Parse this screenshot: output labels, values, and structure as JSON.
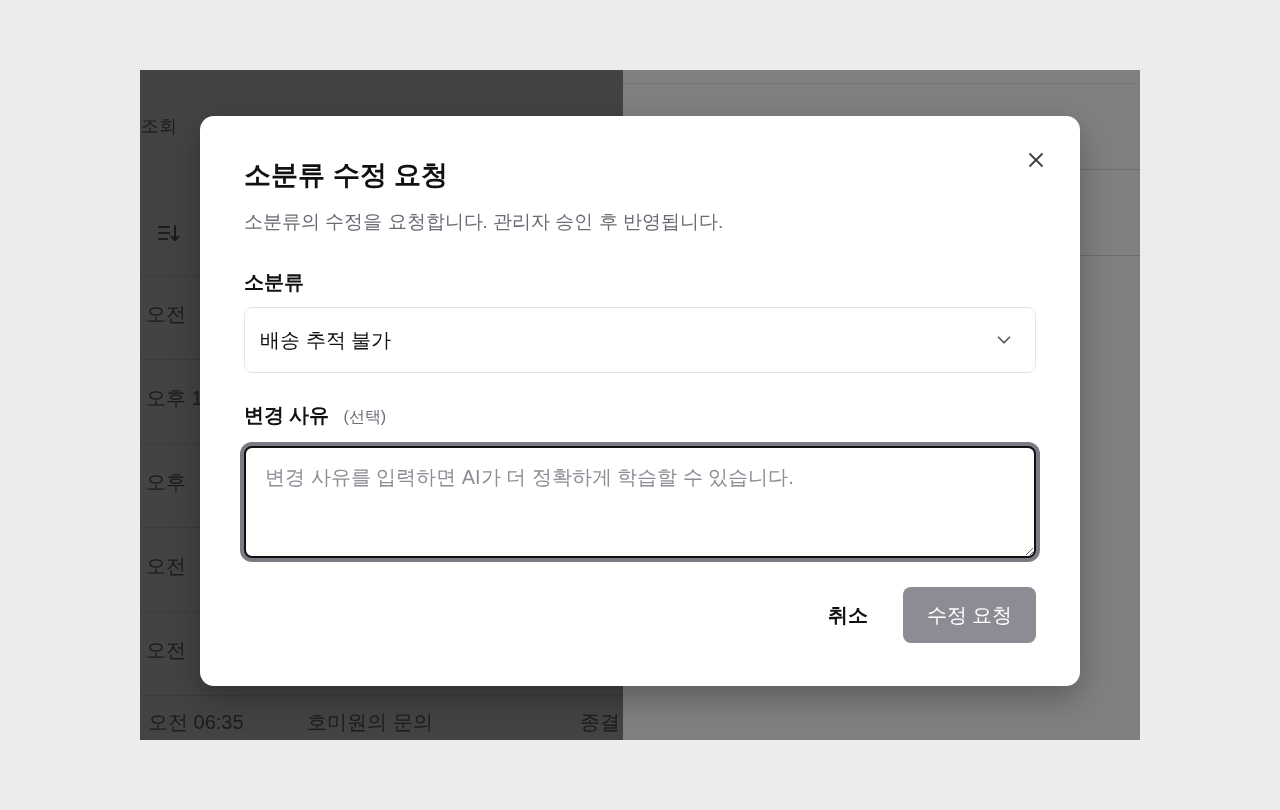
{
  "background": {
    "list": {
      "toolbar_text": "조회",
      "rows": [
        {
          "time": "오전"
        },
        {
          "time": "오후 1"
        },
        {
          "time": "오후"
        },
        {
          "time": "오전"
        },
        {
          "time": "오전"
        },
        {
          "time": "오전 06:35",
          "subject": "호미원의 문의",
          "status": "종결"
        }
      ]
    }
  },
  "dialog": {
    "title": "소분류 수정 요청",
    "description": "소분류의 수정을 요청합니다. 관리자 승인 후 반영됩니다.",
    "fields": [
      {
        "kind": "select",
        "label": "소분류",
        "value": "배송 추적 불가"
      },
      {
        "kind": "textarea",
        "label": "변경 사유",
        "hint": "(선택)",
        "placeholder": "변경 사유를 입력하면 AI가 더 정확하게 학습할 수 있습니다.",
        "focused": true
      }
    ],
    "buttons": [
      {
        "kind": "text",
        "label": "취소",
        "disabled": false
      },
      {
        "kind": "primary",
        "label": "수정 요청",
        "disabled": true
      }
    ]
  }
}
